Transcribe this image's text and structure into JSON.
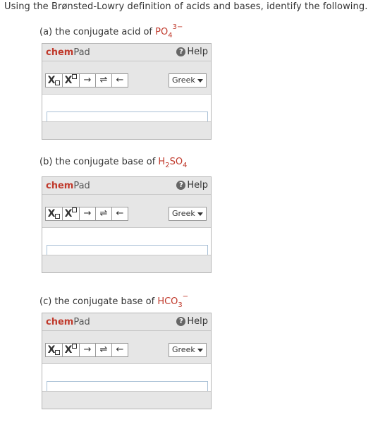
{
  "intro": "Using the Brønsted-Lowry definition of acids and bases, identify the following.",
  "questions": [
    {
      "prefix": "(a) the conjugate acid of ",
      "formula_main": "PO",
      "formula_sub": "4",
      "formula_sup": "3−"
    },
    {
      "prefix": "(b) the conjugate base of ",
      "formula_main": "H",
      "formula_sub1": "2",
      "formula_mid": "SO",
      "formula_sub2": "4"
    },
    {
      "prefix": "(c) the conjugate base of ",
      "formula_main": "HCO",
      "formula_sub": "3",
      "formula_sup": "−"
    }
  ],
  "chempad": {
    "title_chem": "chem",
    "title_pad": "Pad",
    "help_label": "Help",
    "help_icon_glyph": "?",
    "subscript_label": "X",
    "superscript_label": "X",
    "arrow_right": "→",
    "arrow_equilibrium": "⇌",
    "arrow_left": "←",
    "greek_label": "Greek"
  },
  "colors": {
    "accent_red": "#c0392b",
    "panel_gray": "#e6e6e6",
    "input_border": "#a9c0d6"
  }
}
